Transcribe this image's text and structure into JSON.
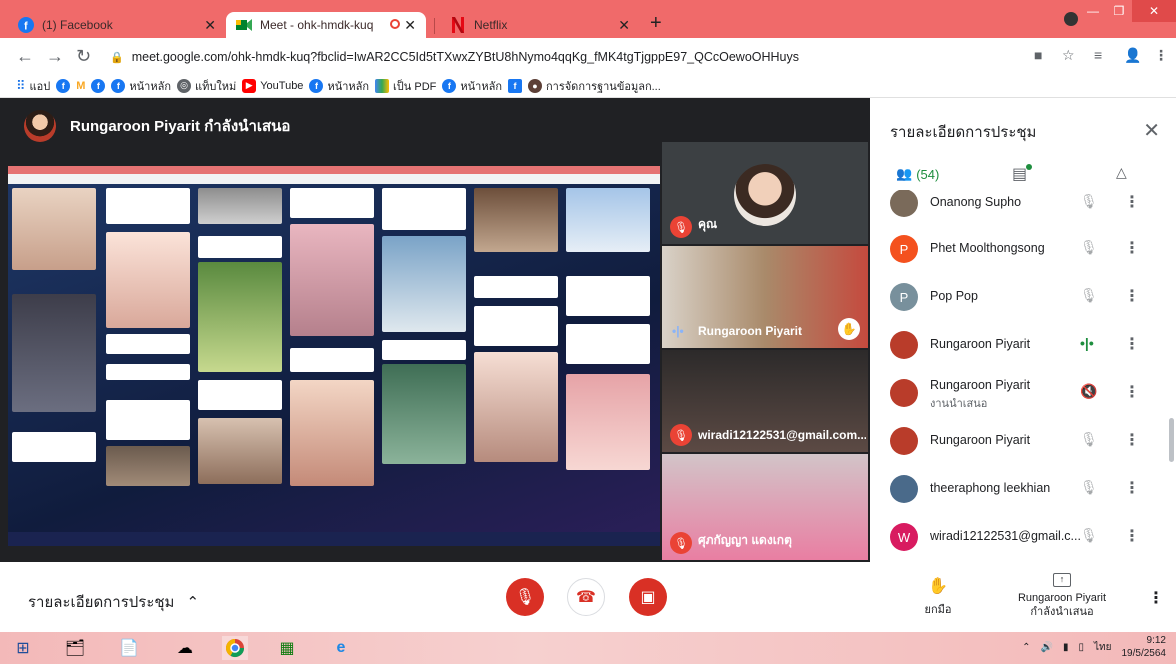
{
  "browser": {
    "tabs": [
      {
        "title": "(1) Facebook",
        "icon": "facebook-icon"
      },
      {
        "title": "Meet - ohk-hmdk-kuq",
        "icon": "meet-icon"
      },
      {
        "title": "Netflix",
        "icon": "netflix-icon"
      }
    ],
    "url": "meet.google.com/ohk-hmdk-kuq?fbclid=IwAR2CC5Id5tTXwxZYBtU8hNymo4qqKg_fMK4tgTjgppE97_QCcOewoOHHuys",
    "bookmarks": [
      "แอป",
      "",
      "",
      "หน้าหลัก",
      "แท็บใหม่",
      "YouTube",
      "หน้าหลัก",
      "เป็น PDF",
      "หน้าหลัก",
      "",
      "การจัดการฐานข้อมูลก..."
    ]
  },
  "meet": {
    "presenter_title": "Rungaroon Piyarit กำลังนำเสนอ",
    "tiles": [
      {
        "name": "คุณ",
        "muted": true
      },
      {
        "name": "Rungaroon Piyarit",
        "muted": false,
        "hand": true
      },
      {
        "name": "wiradi12122531@gmail.com...",
        "muted": true
      },
      {
        "name": "ศุภกัญญา แดงเกตุ",
        "muted": true
      }
    ]
  },
  "panel": {
    "title": "รายละเอียดการประชุม",
    "people_count": "(54)",
    "people": [
      {
        "name": "Onanong Supho",
        "sub": "",
        "initial": "",
        "color": "#7a6a5a",
        "mic": "muted"
      },
      {
        "name": "Phet Moolthongsong",
        "sub": "",
        "initial": "P",
        "color": "#f4511e",
        "mic": "muted"
      },
      {
        "name": "Pop Pop",
        "sub": "",
        "initial": "P",
        "color": "#78909c",
        "mic": "muted"
      },
      {
        "name": "Rungaroon Piyarit",
        "sub": "",
        "initial": "",
        "color": "#b93c2a",
        "mic": "speaking"
      },
      {
        "name": "Rungaroon Piyarit",
        "sub": "งานนำเสนอ",
        "initial": "",
        "color": "#b93c2a",
        "mic": "presenting"
      },
      {
        "name": "Rungaroon Piyarit",
        "sub": "",
        "initial": "",
        "color": "#b93c2a",
        "mic": "muted"
      },
      {
        "name": "theeraphong leekhian",
        "sub": "",
        "initial": "",
        "color": "#4a6a8a",
        "mic": "muted"
      },
      {
        "name": "wiradi12122531@gmail.c...",
        "sub": "",
        "initial": "W",
        "color": "#d81b60",
        "mic": "muted"
      }
    ]
  },
  "bottom": {
    "meeting_details": "รายละเอียดการประชุม",
    "raise_hand": "ยกมือ",
    "presenter_name": "Rungaroon Piyarit",
    "presenter_status": "กำลังนำเสนอ"
  },
  "taskbar": {
    "lang": "ไทย",
    "time": "9:12",
    "date": "19/5/2564"
  }
}
